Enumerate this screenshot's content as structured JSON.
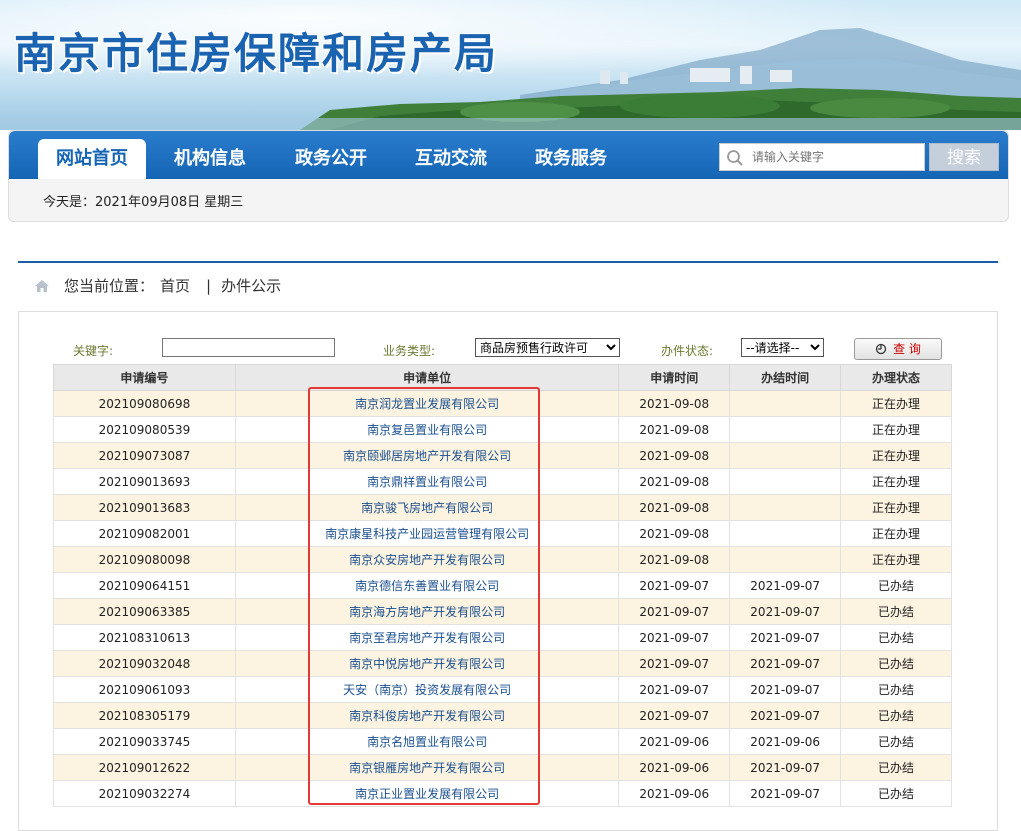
{
  "header": {
    "site_title": "南京市住房保障和房产局"
  },
  "nav": {
    "items": [
      "网站首页",
      "机构信息",
      "政务公开",
      "互动交流",
      "政务服务"
    ],
    "search_placeholder": "请输入关键字",
    "search_button": "搜索",
    "today": "今天是：2021年09月08日 星期三"
  },
  "breadcrumb": {
    "prefix": "您当前位置：",
    "home": "首页",
    "sep": "|",
    "current": "办件公示"
  },
  "filters": {
    "keyword_label": "关键字:",
    "keyword_value": "",
    "type_label": "业务类型:",
    "type_value": "商品房预售行政许可",
    "status_label": "办件状态:",
    "status_value": "--请选择--",
    "query_button": "查 询"
  },
  "table": {
    "headers": [
      "申请编号",
      "申请单位",
      "申请时间",
      "办结时间",
      "办理状态"
    ],
    "rows": [
      [
        "202109080698",
        "南京润龙置业发展有限公司",
        "2021-09-08",
        "",
        "正在办理"
      ],
      [
        "202109080539",
        "南京复邑置业有限公司",
        "2021-09-08",
        "",
        "正在办理"
      ],
      [
        "202109073087",
        "南京颐邺居房地产开发有限公司",
        "2021-09-08",
        "",
        "正在办理"
      ],
      [
        "202109013693",
        "南京鼎祥置业有限公司",
        "2021-09-08",
        "",
        "正在办理"
      ],
      [
        "202109013683",
        "南京骏飞房地产有限公司",
        "2021-09-08",
        "",
        "正在办理"
      ],
      [
        "202109082001",
        "南京康星科技产业园运营管理有限公司",
        "2021-09-08",
        "",
        "正在办理"
      ],
      [
        "202109080098",
        "南京众安房地产开发有限公司",
        "2021-09-08",
        "",
        "正在办理"
      ],
      [
        "202109064151",
        "南京德信东善置业有限公司",
        "2021-09-07",
        "2021-09-07",
        "已办结"
      ],
      [
        "202109063385",
        "南京海方房地产开发有限公司",
        "2021-09-07",
        "2021-09-07",
        "已办结"
      ],
      [
        "202108310613",
        "南京至君房地产开发有限公司",
        "2021-09-07",
        "2021-09-07",
        "已办结"
      ],
      [
        "202109032048",
        "南京中悦房地产开发有限公司",
        "2021-09-07",
        "2021-09-07",
        "已办结"
      ],
      [
        "202109061093",
        "天安（南京）投资发展有限公司",
        "2021-09-07",
        "2021-09-07",
        "已办结"
      ],
      [
        "202108305179",
        "南京科俊房地产开发有限公司",
        "2021-09-07",
        "2021-09-07",
        "已办结"
      ],
      [
        "202109033745",
        "南京名旭置业有限公司",
        "2021-09-06",
        "2021-09-06",
        "已办结"
      ],
      [
        "202109012622",
        "南京银雁房地产开发有限公司",
        "2021-09-06",
        "2021-09-07",
        "已办结"
      ],
      [
        "202109032274",
        "南京正业置业发展有限公司",
        "2021-09-06",
        "2021-09-07",
        "已办结"
      ]
    ]
  }
}
